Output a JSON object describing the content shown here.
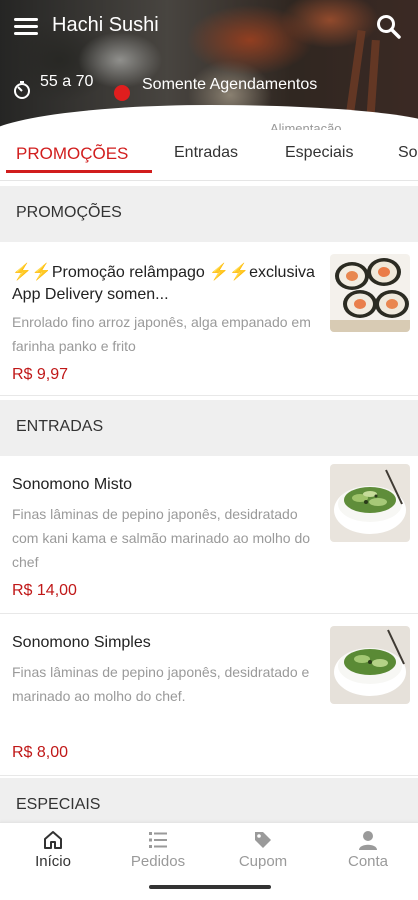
{
  "header": {
    "title": "Hachi Sushi",
    "time_range": "55 a 70",
    "schedule_status": "Somente Agendamentos",
    "category_tag": "Alimentação",
    "status_color": "#e01e1e"
  },
  "tabs": [
    {
      "label": "PROMOÇÕES",
      "active": true
    },
    {
      "label": "Entradas",
      "active": false
    },
    {
      "label": "Especiais",
      "active": false
    },
    {
      "label": "So",
      "active": false
    }
  ],
  "sections": [
    {
      "title": "PROMOÇÕES",
      "items": [
        {
          "title": "⚡⚡Promoção relâmpago ⚡⚡exclusiva App Delivery somen...",
          "description": "Enrolado fino arroz japonês, alga empanado em farinha panko e frito",
          "price": "R$ 9,97",
          "image": "sushi-roll-photo"
        }
      ]
    },
    {
      "title": "ENTRADAS",
      "items": [
        {
          "title": "Sonomono Misto",
          "description": "Finas lâminas de pepino japonês, desidratado com kani kama e salmão marinado ao molho do chef",
          "price": "R$ 14,00",
          "image": "cucumber-salad-photo"
        },
        {
          "title": "Sonomono Simples",
          "description": "Finas lâminas de pepino japonês, desidratado e marinado ao molho do chef.",
          "price": "R$ 8,00",
          "image": "cucumber-salad-photo"
        }
      ]
    },
    {
      "title": "ESPECIAIS",
      "items": []
    }
  ],
  "bottom_nav": [
    {
      "label": "Início",
      "icon": "home-icon",
      "active": true
    },
    {
      "label": "Pedidos",
      "icon": "list-icon",
      "active": false
    },
    {
      "label": "Cupom",
      "icon": "tag-icon",
      "active": false
    },
    {
      "label": "Conta",
      "icon": "user-icon",
      "active": false
    }
  ],
  "colors": {
    "accent": "#d11d1d",
    "price": "#c01818",
    "section_bg": "#efefef"
  }
}
